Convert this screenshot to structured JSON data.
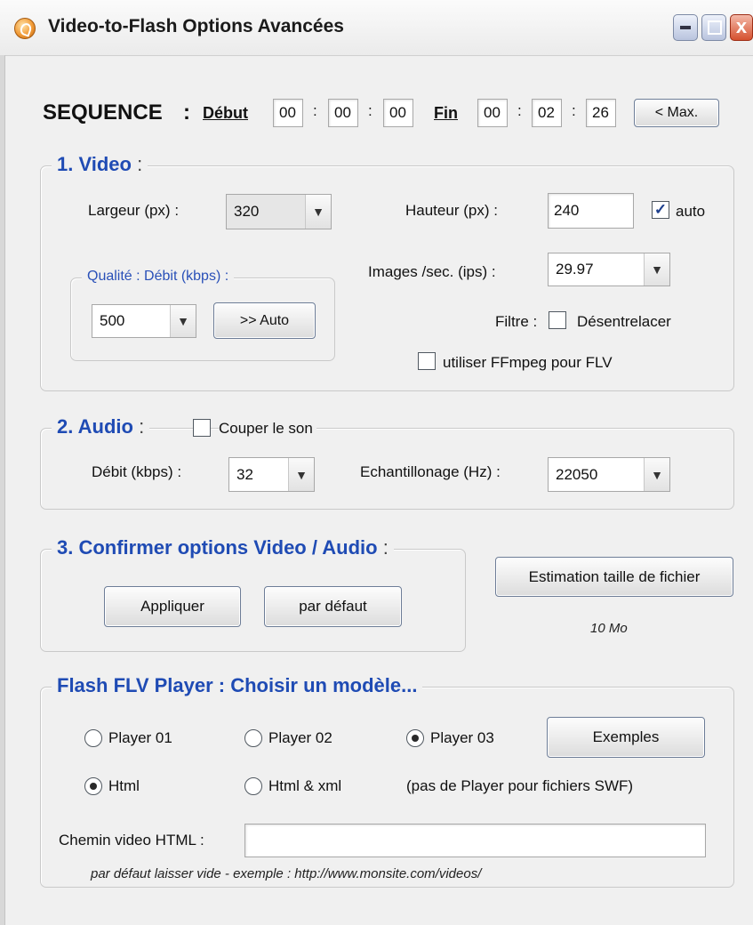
{
  "window": {
    "title": "Video-to-Flash Options Avancées",
    "close_glyph": "x"
  },
  "sequence": {
    "label": "SEQUENCE",
    "colon": ":",
    "start_label": "Début",
    "start": [
      "00",
      "00",
      "00"
    ],
    "end_label": "Fin",
    "end": [
      "00",
      "02",
      "26"
    ],
    "sep": ":",
    "max_button": "< Max."
  },
  "video": {
    "legend": "1. Video",
    "colon": ":",
    "width_label": "Largeur (px) :",
    "width_value": "320",
    "height_label": "Hauteur (px)  :",
    "height_value": "240",
    "auto_label": "auto",
    "auto_checked": "✓",
    "quality_legend": "Qualité : Débit  (kbps) :",
    "bitrate_value": "500",
    "auto_button": ">> Auto",
    "fps_label": "Images /sec. (ips) :",
    "fps_value": "29.97",
    "filter_label": "Filtre :",
    "deinterlace_label": "Désentrelacer",
    "ffmpeg_label": "utiliser FFmpeg pour FLV"
  },
  "audio": {
    "legend": "2. Audio",
    "colon": ":",
    "mute_label": "Couper le son",
    "bitrate_label": "Débit  (kbps) :",
    "bitrate_value": "32",
    "sample_label": "Echantillonage (Hz) :",
    "sample_value": "22050"
  },
  "confirm": {
    "legend": "3. Confirmer options Video / Audio",
    "colon": ":",
    "apply_button": "Appliquer",
    "default_button": "par défaut",
    "estimate_button": "Estimation taille de fichier",
    "estimate_value": "10 Mo"
  },
  "player": {
    "legend": "Flash FLV Player : Choisir un modèle...",
    "player01": "Player 01",
    "player02": "Player 02",
    "player03": "Player 03",
    "examples_button": "Exemples",
    "html": "Html",
    "html_xml": "Html & xml",
    "swf_note": "(pas de Player pour fichiers SWF)",
    "path_label": "Chemin video HTML :",
    "path_value": "",
    "hint": "par défaut laisser vide  -  exemple : http://www.monsite.com/videos/"
  },
  "icons": {
    "app": "video-to-flash-app-icon",
    "dropdown": "chevron-down-icon"
  }
}
